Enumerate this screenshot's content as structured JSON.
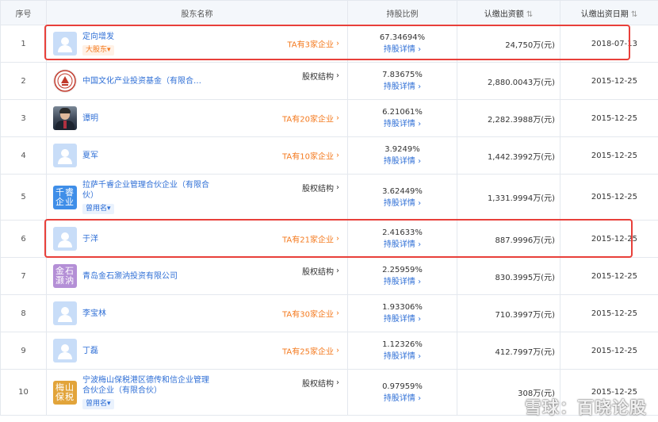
{
  "headers": {
    "no": "序号",
    "name": "股东名称",
    "pct": "持股比例",
    "amount": "认缴出资额",
    "date": "认缴出资日期"
  },
  "detail_label": "持股详情",
  "rows": [
    {
      "no": "1",
      "name": "定向增发",
      "avatar": "person-icon",
      "tag": "大股东",
      "right": "TA有3家企业",
      "pct": "67.34694%",
      "amount": "24,750万(元)",
      "date": "2018-07-13"
    },
    {
      "no": "2",
      "name": "中国文化产业投资基金（有限合…",
      "avatar": "logo",
      "right": "股权结构",
      "pct": "7.83675%",
      "amount": "2,880.0043万(元)",
      "date": "2015-12-25"
    },
    {
      "no": "3",
      "name": "谭明",
      "avatar": "photo",
      "right": "TA有20家企业",
      "pct": "6.21061%",
      "amount": "2,282.3988万(元)",
      "date": "2015-12-25"
    },
    {
      "no": "4",
      "name": "夏军",
      "avatar": "person-icon",
      "right": "TA有10家企业",
      "pct": "3.9249%",
      "amount": "1,442.3992万(元)",
      "date": "2015-12-25"
    },
    {
      "no": "5",
      "name": "拉萨千睿企业管理合伙企业（有限合伙）",
      "avatar_text": "千睿企业",
      "avatar_color": "#3f8ee8",
      "tag": "曾用名",
      "right": "股权结构",
      "pct": "3.62449%",
      "amount": "1,331.9994万(元)",
      "date": "2015-12-25"
    },
    {
      "no": "6",
      "name": "于洋",
      "avatar": "person-icon",
      "right": "TA有21家企业",
      "pct": "2.41633%",
      "amount": "887.9996万(元)",
      "date": "2015-12-25"
    },
    {
      "no": "7",
      "name": "青岛金石灏汭投资有限公司",
      "avatar_text": "金石灏汭",
      "avatar_color": "#b48fd6",
      "right": "股权结构",
      "pct": "2.25959%",
      "amount": "830.3995万(元)",
      "date": "2015-12-25"
    },
    {
      "no": "8",
      "name": "李宝林",
      "avatar": "person-icon",
      "right": "TA有30家企业",
      "pct": "1.93306%",
      "amount": "710.3997万(元)",
      "date": "2015-12-25"
    },
    {
      "no": "9",
      "name": "丁磊",
      "avatar": "person-icon",
      "right": "TA有25家企业",
      "pct": "1.12326%",
      "amount": "412.7997万(元)",
      "date": "2015-12-25"
    },
    {
      "no": "10",
      "name": "宁波梅山保税港区德传和信企业管理合伙企业（有限合伙）",
      "avatar_text": "梅山保税",
      "avatar_color": "#e2a43a",
      "tag": "曾用名",
      "right": "股权结构",
      "pct": "0.97959%",
      "amount": "308万(元)",
      "date": "2015-12-25"
    }
  ],
  "watermark": "雪球：百晓论股",
  "colors": {
    "highlight": "#e8403a",
    "link": "#2f6fd6",
    "orange": "#f47a1f"
  }
}
